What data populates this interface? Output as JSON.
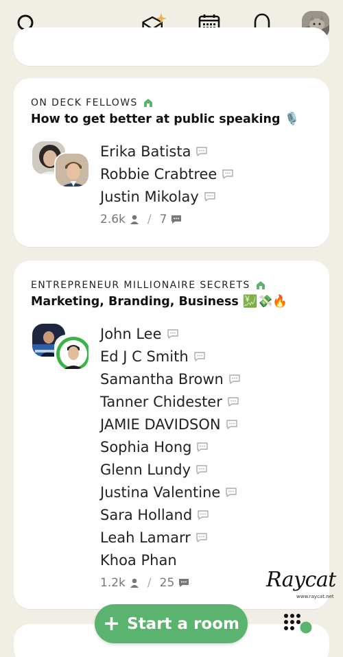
{
  "topbar": {
    "icons": [
      "search-icon",
      "invite-envelope-icon",
      "calendar-icon",
      "bell-icon",
      "profile-avatar"
    ]
  },
  "rooms": [
    {
      "club": "ON DECK FELLOWS",
      "topic": "How to get better at public speaking",
      "topic_emoji": "🎙️",
      "speakers": [
        "Erika Batista",
        "Robbie Crabtree",
        "Justin Mikolay"
      ],
      "listeners": "2.6k",
      "chats": "7"
    },
    {
      "club": "ENTREPRENEUR MILLIONAIRE SECRETS",
      "topic": "Marketing, Branding, Business",
      "topic_emoji": "💹💸🔥",
      "speakers": [
        "John Lee",
        "Ed J C Smith",
        "Samantha Brown",
        "Tanner Chidester",
        "JAMIE DAVIDSON",
        "Sophia Hong",
        "Glenn Lundy",
        "Justina Valentine",
        "Sara Holland",
        "Leah Lamarr",
        "Khoa Phan"
      ],
      "listeners": "1.2k",
      "chats": "25"
    }
  ],
  "actions": {
    "start_room_plus": "+",
    "start_room_label": "Start a room"
  },
  "watermark": {
    "text": "Raycat",
    "url": "www.raycat.net"
  },
  "colors": {
    "background": "#f1efe5",
    "accent_green": "#5ab46f",
    "card": "#ffffff"
  }
}
